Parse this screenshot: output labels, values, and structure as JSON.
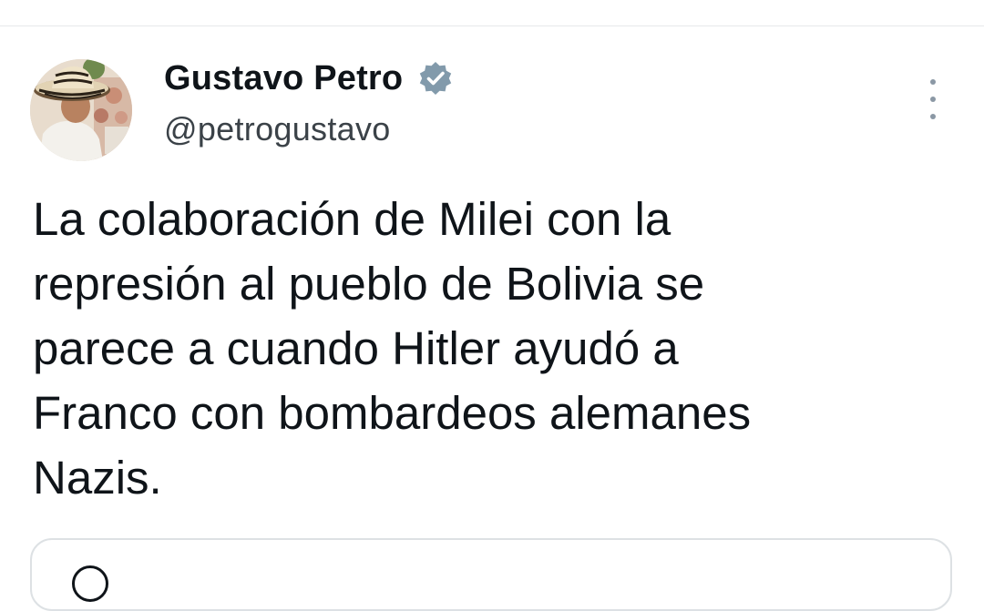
{
  "tweet": {
    "author": {
      "display_name": "Gustavo Petro",
      "handle": "@petrogustavo",
      "verified_icon": "verified-badge-icon",
      "verified_color": "#829aab"
    },
    "text": "La colaboración de Milei con la\nrepresión al pueblo de Bolivia se\nparece a cuando Hitler ayudó a\nFranco con bombardeos alemanes\nNazis.",
    "menu_icon": "more-vertical-icon"
  }
}
